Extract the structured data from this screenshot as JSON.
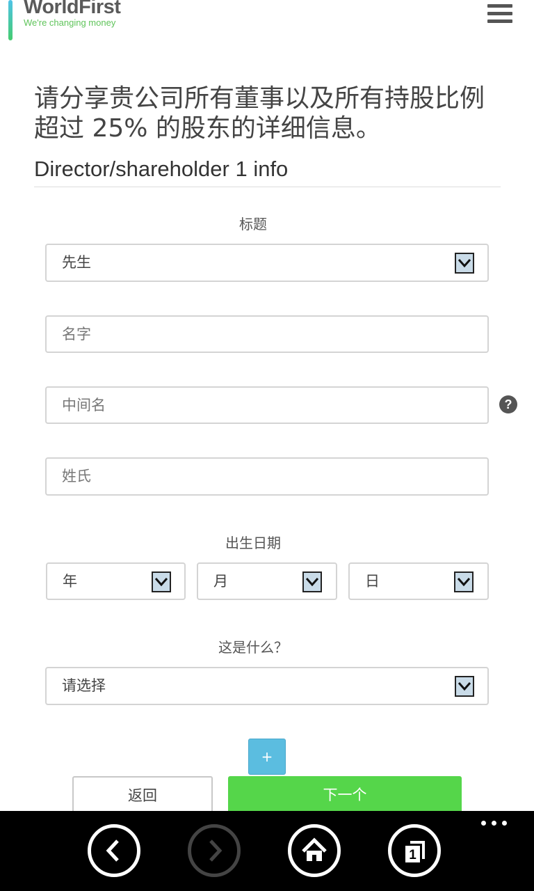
{
  "header": {
    "logo_name": "WorldFirst",
    "logo_tagline": "We're changing money",
    "menu_icon": "hamburger-menu-icon"
  },
  "page": {
    "headline": "请分享贵公司所有董事以及所有持股比例超过 25% 的股东的详细信息。",
    "section_title": "Director/shareholder 1 info"
  },
  "form": {
    "title_label": "标题",
    "title_value": "先生",
    "first_name_placeholder": "名字",
    "middle_name_placeholder": "中间名",
    "last_name_placeholder": "姓氏",
    "help_icon": "question-mark-icon",
    "help_glyph": "?",
    "dob_label": "出生日期",
    "dob_year": "年",
    "dob_month": "月",
    "dob_day": "日",
    "role_label": "这是什么？",
    "role_value": "请选择",
    "dropdown_icon": "chevron-down-icon"
  },
  "actions": {
    "add_label": "+",
    "back_label": "返回",
    "next_label": "下一个"
  },
  "browser_bar": {
    "back_icon": "back-arrow-icon",
    "forward_icon": "forward-arrow-icon",
    "home_icon": "home-icon",
    "tabs_icon": "tabs-icon",
    "tabs_count": "1",
    "more_icon": "more-dots-icon"
  },
  "colors": {
    "next_button": "#55d64a",
    "add_button": "#5bbde0",
    "logo_tagline": "#5fc45a",
    "dropdown_button": "#c9dbe8"
  }
}
